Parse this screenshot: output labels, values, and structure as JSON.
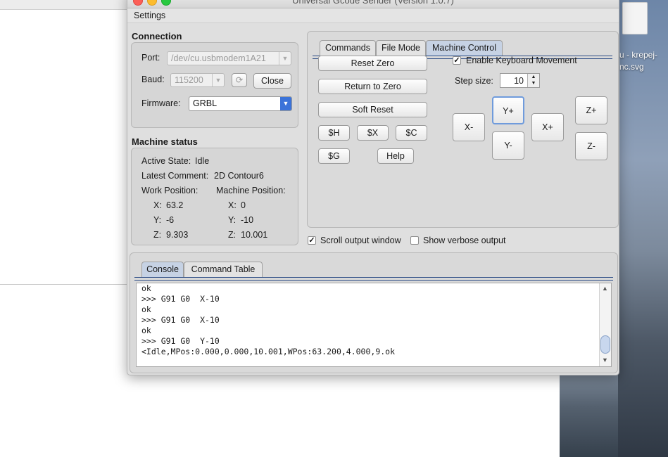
{
  "window": {
    "title": "Universal Gcode Sender (Version 1.0.7)"
  },
  "menu": {
    "settings": "Settings"
  },
  "desktop": {
    "icon_label_1": "u - krepej-",
    "icon_label_2": "nc.svg"
  },
  "connection": {
    "title": "Connection",
    "port_label": "Port:",
    "port_value": "/dev/cu.usbmodem1A21",
    "baud_label": "Baud:",
    "baud_value": "115200",
    "close_button": "Close",
    "firmware_label": "Firmware:",
    "firmware_value": "GRBL"
  },
  "machine_status": {
    "title": "Machine status",
    "active_state_label": "Active State:",
    "active_state_value": "Idle",
    "latest_comment_label": "Latest Comment:",
    "latest_comment_value": "2D Contour6",
    "work_position_label": "Work Position:",
    "machine_position_label": "Machine Position:",
    "work": {
      "x_label": "X:",
      "x": "63.2",
      "y_label": "Y:",
      "y": "-6",
      "z_label": "Z:",
      "z": "9.303"
    },
    "machine": {
      "x_label": "X:",
      "x": "0",
      "y_label": "Y:",
      "y": "-10",
      "z_label": "Z:",
      "z": "10.001"
    }
  },
  "tabs": {
    "commands": "Commands",
    "file_mode": "File Mode",
    "machine_control": "Machine Control",
    "selected": "Machine Control"
  },
  "machine_control": {
    "reset_zero": "Reset Zero",
    "return_to_zero": "Return to Zero",
    "soft_reset": "Soft Reset",
    "cmd_h": "$H",
    "cmd_x": "$X",
    "cmd_c": "$C",
    "cmd_g": "$G",
    "help": "Help",
    "enable_keyboard": "Enable Keyboard Movement",
    "enable_keyboard_checked": true,
    "step_size_label": "Step size:",
    "step_size_value": "10",
    "jog": {
      "x_minus": "X-",
      "x_plus": "X+",
      "y_plus": "Y+",
      "y_minus": "Y-",
      "z_plus": "Z+",
      "z_minus": "Z-"
    }
  },
  "options": {
    "scroll_output": "Scroll output window",
    "scroll_output_checked": true,
    "verbose_output": "Show verbose output",
    "verbose_output_checked": false
  },
  "console_tabs": {
    "console": "Console",
    "command_table": "Command Table"
  },
  "console": {
    "lines": [
      "ok",
      ">>> G91 G0  X-10",
      "ok",
      ">>> G91 G0  X-10",
      "ok",
      ">>> G91 G0  Y-10",
      "<Idle,MPos:0.000,0.000,10.001,WPos:63.200,4.000,9.ok"
    ]
  },
  "colors": {
    "window_bg": "#dfdfdf",
    "selected_tab": "#c6d2e4",
    "accent_blue": "#3b73d9",
    "traffic_red": "#fc5f57",
    "traffic_yellow": "#fdbc2e",
    "traffic_green": "#29c940"
  }
}
